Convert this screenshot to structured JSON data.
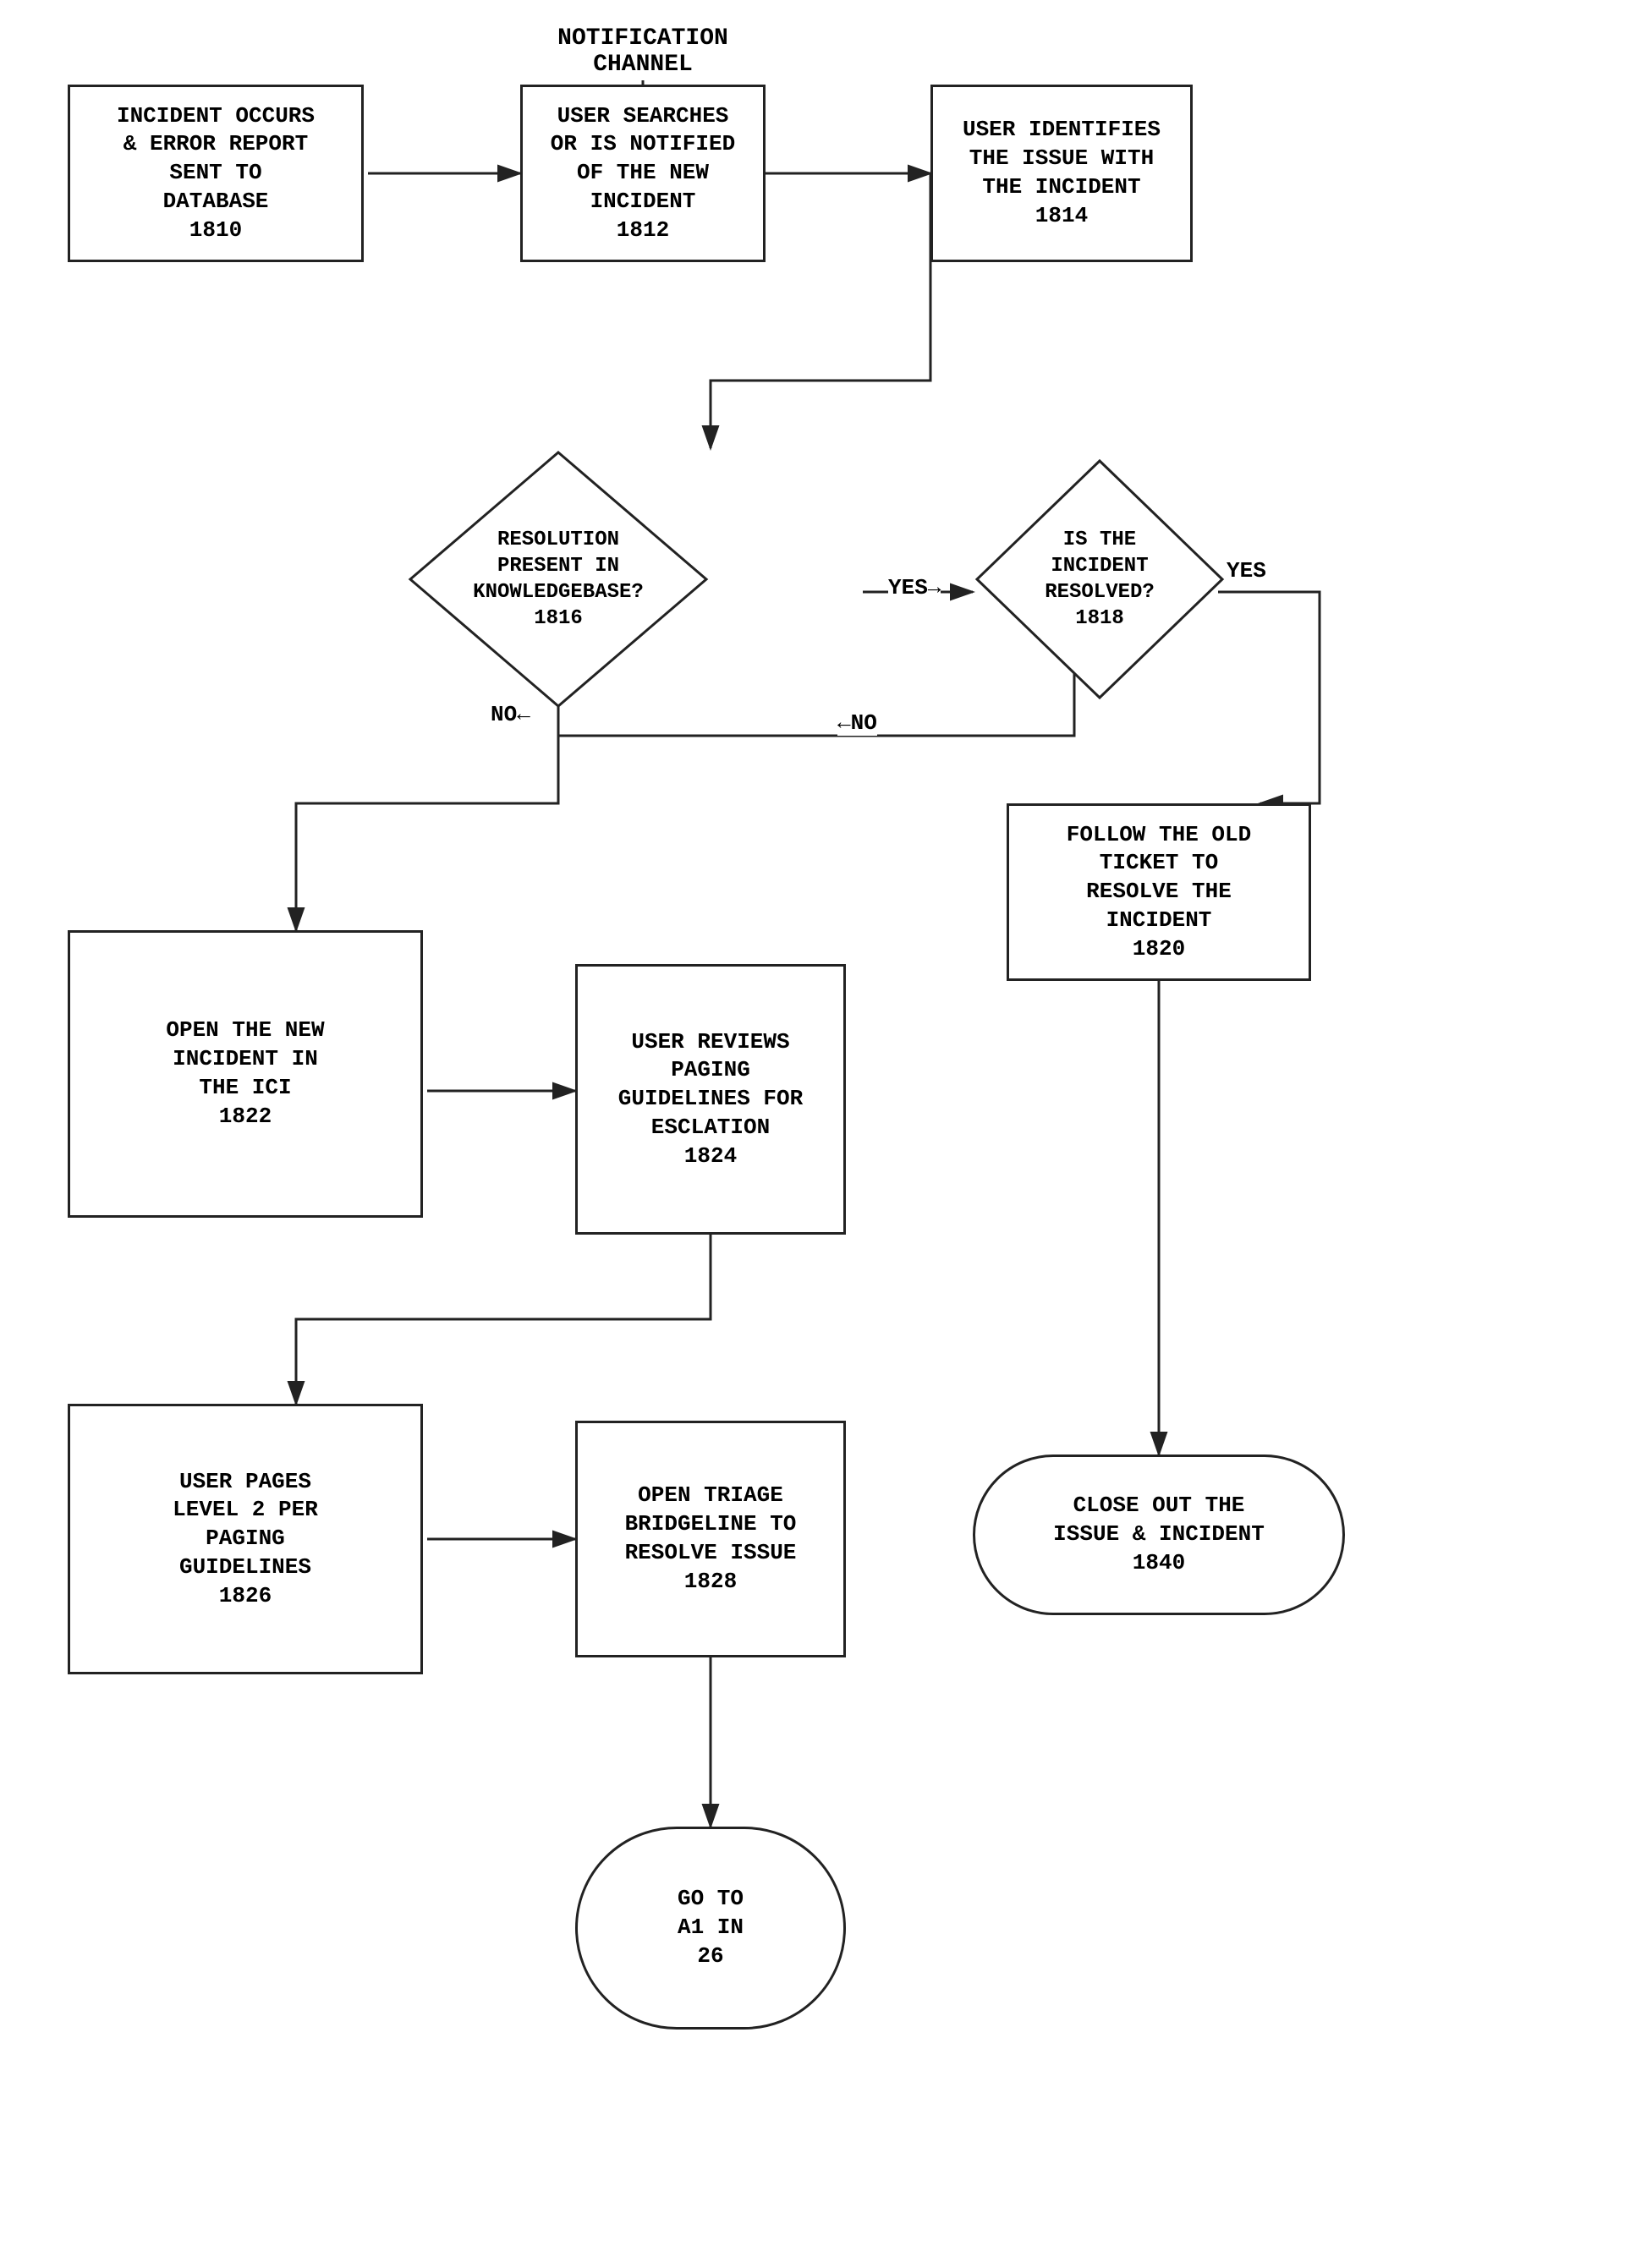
{
  "diagram": {
    "title": "NOTIFICATION CHANNEL",
    "nodes": [
      {
        "id": "1810",
        "type": "box",
        "label": "INCIDENT OCCURS\n& ERROR REPORT\nSENT TO\nDATABASE\n1810"
      },
      {
        "id": "1812",
        "type": "box",
        "label": "USER SEARCHES\nOR IS NOTIFIED\nOF THE NEW\nINCIDENT\n1812"
      },
      {
        "id": "1814",
        "type": "box",
        "label": "USER IDENTIFIES\nTHE ISSUE WITH\nTHE INCIDENT\n1814"
      },
      {
        "id": "1816",
        "type": "diamond",
        "label": "RESOLUTION\nPRESENT IN\nKNOWLEDGEBASE?\n1816"
      },
      {
        "id": "1818",
        "type": "diamond",
        "label": "IS THE\nINCIDENT\nRESOLVED?\n1818"
      },
      {
        "id": "1820",
        "type": "box",
        "label": "FOLLOW THE OLD\nTICKET TO\nRESOLVE THE\nINCIDENT\n1820"
      },
      {
        "id": "1822",
        "type": "box",
        "label": "OPEN THE NEW\nINCIDENT IN\nTHE ICI\n1822"
      },
      {
        "id": "1824",
        "type": "box",
        "label": "USER REVIEWS\nPAGING\nGUIDELINES FOR\nESCLATION\n1824"
      },
      {
        "id": "1826",
        "type": "box",
        "label": "USER PAGES\nLEVEL 2 PER\nPAGING\nGUIDELINES\n1826"
      },
      {
        "id": "1828",
        "type": "box",
        "label": "OPEN TRIAGE\nBRIDGELINE TO\nRESOLVE ISSUE\n1828"
      },
      {
        "id": "1840",
        "type": "oval",
        "label": "CLOSE OUT THE\nISSUE & INCIDENT\n1840"
      },
      {
        "id": "A1",
        "type": "oval",
        "label": "GO TO\nA1 IN\n26"
      }
    ],
    "labels": {
      "yes": "YES",
      "no": "NO",
      "notification_channel": "NOTIFICATION\nCHANNEL"
    }
  }
}
